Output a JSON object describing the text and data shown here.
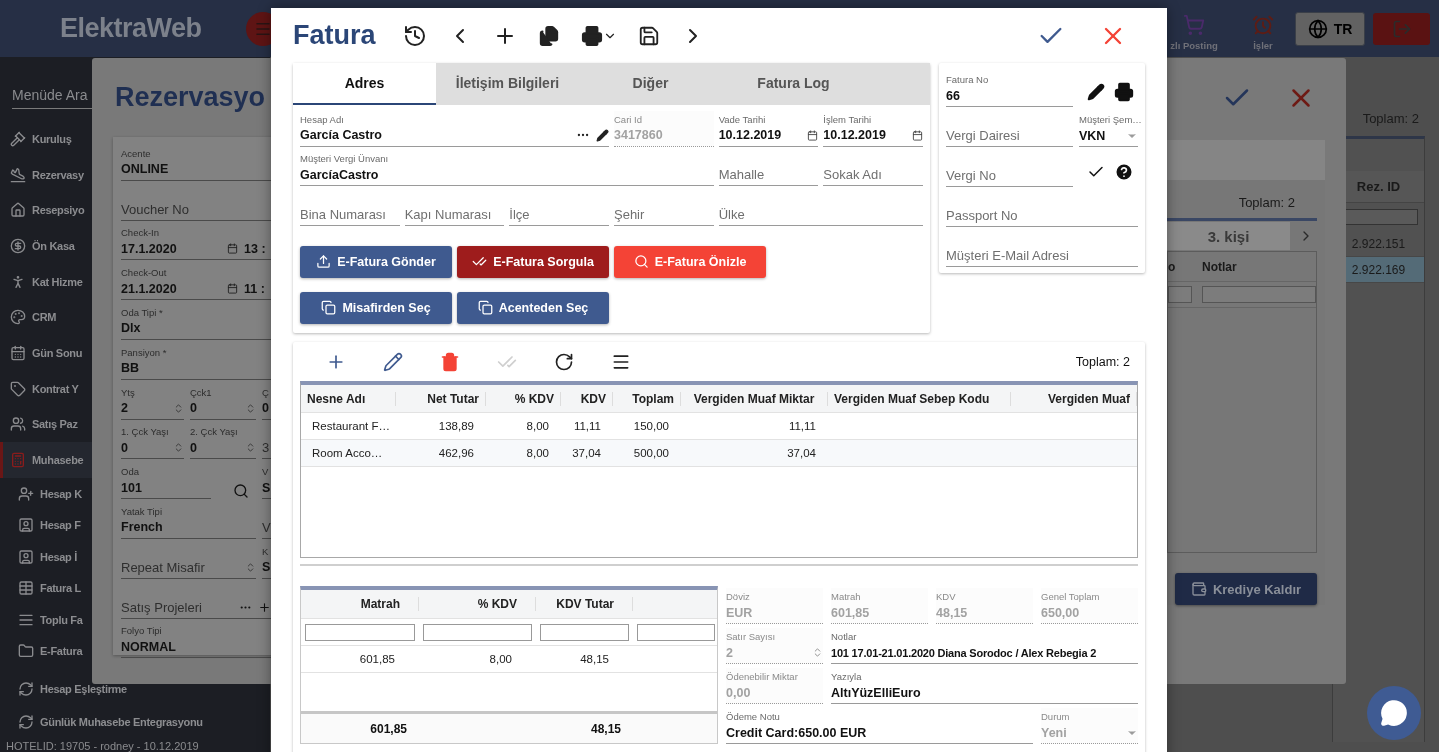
{
  "header": {
    "logo": "ElektraWeb",
    "tools": [
      {
        "kind": "cart",
        "label": "zlı Posting"
      },
      {
        "kind": "alarm",
        "label": "İşler"
      }
    ],
    "language": "TR"
  },
  "sidebar": {
    "search": {
      "placeholder": "Menüde Ara"
    },
    "items": [
      {
        "kind": "gavel",
        "label": "Kuruluş",
        "selected": false
      },
      {
        "kind": "plane",
        "label": "Rezervasy",
        "selected": false
      },
      {
        "kind": "home",
        "label": "Resepsiyo",
        "selected": false
      },
      {
        "kind": "dollar",
        "label": "Ön Kasa",
        "selected": false
      },
      {
        "kind": "person",
        "label": "Kat Hizme",
        "selected": false
      },
      {
        "kind": "palette",
        "label": "CRM",
        "selected": false
      },
      {
        "kind": "calendar",
        "label": "Gün Sonu",
        "selected": false
      },
      {
        "kind": "tag",
        "label": "Kontrat Y",
        "selected": false
      },
      {
        "kind": "users",
        "label": "Satış Paz",
        "selected": false
      },
      {
        "kind": "calculator",
        "label": "Muhasebe",
        "selected": true,
        "children": [
          {
            "kind": "user-plus",
            "label": "Hesap K"
          },
          {
            "kind": "contact",
            "label": "Hesap F"
          },
          {
            "kind": "contact",
            "label": "Hesap İ"
          },
          {
            "kind": "table",
            "label": "Fatura L"
          },
          {
            "kind": "lines",
            "label": "Toplu Fa"
          },
          {
            "kind": "folder",
            "label": "E-Fatura"
          },
          {
            "kind": "sync",
            "label": "Hesap Eşleştirme"
          },
          {
            "kind": "sync",
            "label": "Günlük Muhasebe Entegrasyonu"
          }
        ]
      }
    ],
    "footer": "HOTELID: 19705 - rodney - 10.12.2019"
  },
  "page_grid": {
    "total": "Toplam: 2",
    "column": "Rez. ID",
    "rows": [
      {
        "value": "2.922.151",
        "selected": false
      },
      {
        "value": "2.922.169",
        "selected": true
      }
    ]
  },
  "reservation": {
    "title": "Rezervasyo",
    "rows": [
      [
        {
          "kind": "text",
          "label": "Acente",
          "value": "ONLINE"
        }
      ],
      [
        {
          "kind": "text",
          "placeholder": "Voucher No"
        }
      ],
      [
        {
          "kind": "date",
          "label": "Check-In",
          "value": "17.1.2020",
          "time": "13 :"
        }
      ],
      [
        {
          "kind": "date",
          "label": "Check-Out",
          "value": "21.1.2020",
          "time": "11 :"
        }
      ],
      [
        {
          "kind": "text",
          "label": "Oda Tipi *",
          "value": "Dlx"
        }
      ],
      [
        {
          "kind": "text",
          "label": "Pansiyon *",
          "value": "BB"
        }
      ],
      [
        {
          "kind": "spin",
          "label": "Ytş",
          "value": "2"
        },
        {
          "kind": "spin",
          "label": "Çck1",
          "value": "0"
        },
        {
          "kind": "text",
          "label": "Ç",
          "value": "0"
        }
      ],
      [
        {
          "kind": "spin",
          "label": "1. Çck Yaşı",
          "value": "0"
        },
        {
          "kind": "spin",
          "label": "2. Çck Yaşı",
          "value": "0"
        },
        {
          "kind": "text",
          "placeholder": "3"
        }
      ],
      [
        {
          "kind": "lookup",
          "label": "Oda",
          "value": "101"
        },
        {
          "kind": "text",
          "label": "V",
          "value": "S"
        }
      ],
      [
        {
          "kind": "text",
          "label": "Yatak Tipi",
          "value": "French"
        },
        {
          "kind": "text",
          "placeholder": "V"
        }
      ],
      [
        {
          "kind": "spin",
          "placeholder": "Repeat Misafir"
        },
        {
          "kind": "text",
          "label": "K",
          "value": "S"
        }
      ],
      [
        {
          "kind": "multi",
          "placeholder": "Satış Projeleri"
        }
      ],
      [
        {
          "kind": "text",
          "label": "Folyo Tipi",
          "value": "NORMAL"
        }
      ]
    ],
    "side": {
      "total": "Toplam: 2",
      "tab": "3. kişi",
      "columns": [
        "o",
        "Notlar"
      ],
      "button": "Krediye Kaldır"
    }
  },
  "invoice": {
    "title": "Fatura",
    "tabs": [
      {
        "label": "Adres",
        "selected": true
      },
      {
        "label": "İletişim Bilgileri",
        "selected": false
      },
      {
        "label": "Diğer",
        "selected": false
      },
      {
        "label": "Fatura Log",
        "selected": false
      }
    ],
    "address": [
      [
        {
          "kind": "account",
          "label": "Hesap Adı",
          "value": "García Castro",
          "disabled": false
        },
        {
          "kind": "text",
          "label": "Cari Id",
          "value": "3417860",
          "disabled": true
        },
        {
          "kind": "date",
          "label": "Vade Tarihi",
          "value": "10.12.2019",
          "disabled": false
        },
        {
          "kind": "date",
          "label": "İşlem Tarihi",
          "value": "10.12.2019",
          "disabled": false
        }
      ],
      [
        {
          "kind": "text",
          "label": "Müşteri Vergi Ünvanı",
          "value": "GarcíaCastro",
          "disabled": false
        },
        {
          "kind": "text",
          "placeholder": "Mahalle",
          "disabled": false
        },
        {
          "kind": "text",
          "placeholder": "Sokak Adı",
          "disabled": false
        }
      ],
      [
        {
          "kind": "text",
          "placeholder": "Bina Numarası",
          "disabled": false
        },
        {
          "kind": "text",
          "placeholder": "Kapı Numarası",
          "disabled": false
        },
        {
          "kind": "text",
          "placeholder": "İlçe",
          "disabled": false
        },
        {
          "kind": "text",
          "placeholder": "Şehir",
          "disabled": false
        },
        {
          "kind": "text",
          "placeholder": "Ülke",
          "disabled": false
        }
      ]
    ],
    "actions": [
      {
        "kind": "send",
        "label": "E-Fatura Gönder"
      },
      {
        "kind": "query",
        "label": "E-Fatura Sorgula"
      },
      {
        "kind": "preview",
        "label": "E-Fatura Önizle"
      },
      {
        "kind": "pick",
        "label": "Misafirden Seç"
      },
      {
        "kind": "pick",
        "label": "Acenteden Seç"
      }
    ],
    "side": {
      "invoice_no": {
        "label": "Fatura No",
        "value": "66"
      },
      "tax_office": {
        "placeholder": "Vergi Dairesi"
      },
      "scheme": {
        "label": "Müşteri Şem…",
        "value": "VKN"
      },
      "tax_no": {
        "placeholder": "Vergi No"
      },
      "passport": {
        "placeholder": "Passport No"
      },
      "email": {
        "placeholder": "Müşteri E-Mail Adresi"
      }
    },
    "toolbar": [
      {
        "kind": "add",
        "disabled": false
      },
      {
        "kind": "edit",
        "disabled": false
      },
      {
        "kind": "delete",
        "disabled": false
      },
      {
        "kind": "approve",
        "disabled": true
      },
      {
        "kind": "refresh",
        "disabled": false
      },
      {
        "kind": "menu",
        "disabled": false
      }
    ],
    "lines": {
      "total": "Toplam: 2",
      "columns": [
        "Nesne Adı",
        "Net Tutar",
        "% KDV",
        "KDV",
        "Toplam",
        "Vergiden Muaf Miktar",
        "Vergiden Muaf Sebep Kodu",
        "Vergiden Muaf"
      ],
      "rows": [
        [
          "Restaurant F…",
          "138,89",
          "8,00",
          "11,11",
          "150,00",
          "11,11"
        ],
        [
          "Room Acco…",
          "462,96",
          "8,00",
          "37,04",
          "500,00",
          "37,04"
        ]
      ]
    },
    "vat_summary": {
      "columns": [
        "Matrah",
        "% KDV",
        "KDV Tutar"
      ],
      "rows": [
        [
          "601,85",
          "8,00",
          "48,15"
        ]
      ],
      "totals": {
        "matrah": "601,85",
        "kdv_tutar": "48,15"
      }
    },
    "details": [
      [
        {
          "kind": "text",
          "label": "Döviz",
          "value": "EUR",
          "disabled": true
        },
        {
          "kind": "text",
          "label": "Matrah",
          "value": "601,85",
          "disabled": true
        },
        {
          "kind": "text",
          "label": "KDV",
          "value": "48,15",
          "disabled": true
        },
        {
          "kind": "text",
          "label": "Genel Toplam",
          "value": "650,00",
          "disabled": true
        }
      ],
      [
        {
          "kind": "spin",
          "label": "Satır Sayısı",
          "value": "2",
          "disabled": true
        },
        {
          "kind": "text",
          "label": "Notlar",
          "value": "101 17.01-21.01.2020 Diana Sorodoc / Alex Rebegia 2",
          "disabled": false
        }
      ],
      [
        {
          "kind": "text",
          "label": "Ödenebilir Miktar",
          "value": "0,00",
          "disabled": true
        },
        {
          "kind": "text",
          "label": "Yazıyla",
          "value": "AltıYüzElliEuro",
          "disabled": false
        }
      ],
      [
        {
          "kind": "text",
          "label": "Ödeme Notu",
          "value": "Credit Card:650.00 EUR",
          "disabled": false
        },
        {
          "kind": "select",
          "label": "Durum",
          "value": "Yeni",
          "disabled": true
        }
      ]
    ]
  }
}
